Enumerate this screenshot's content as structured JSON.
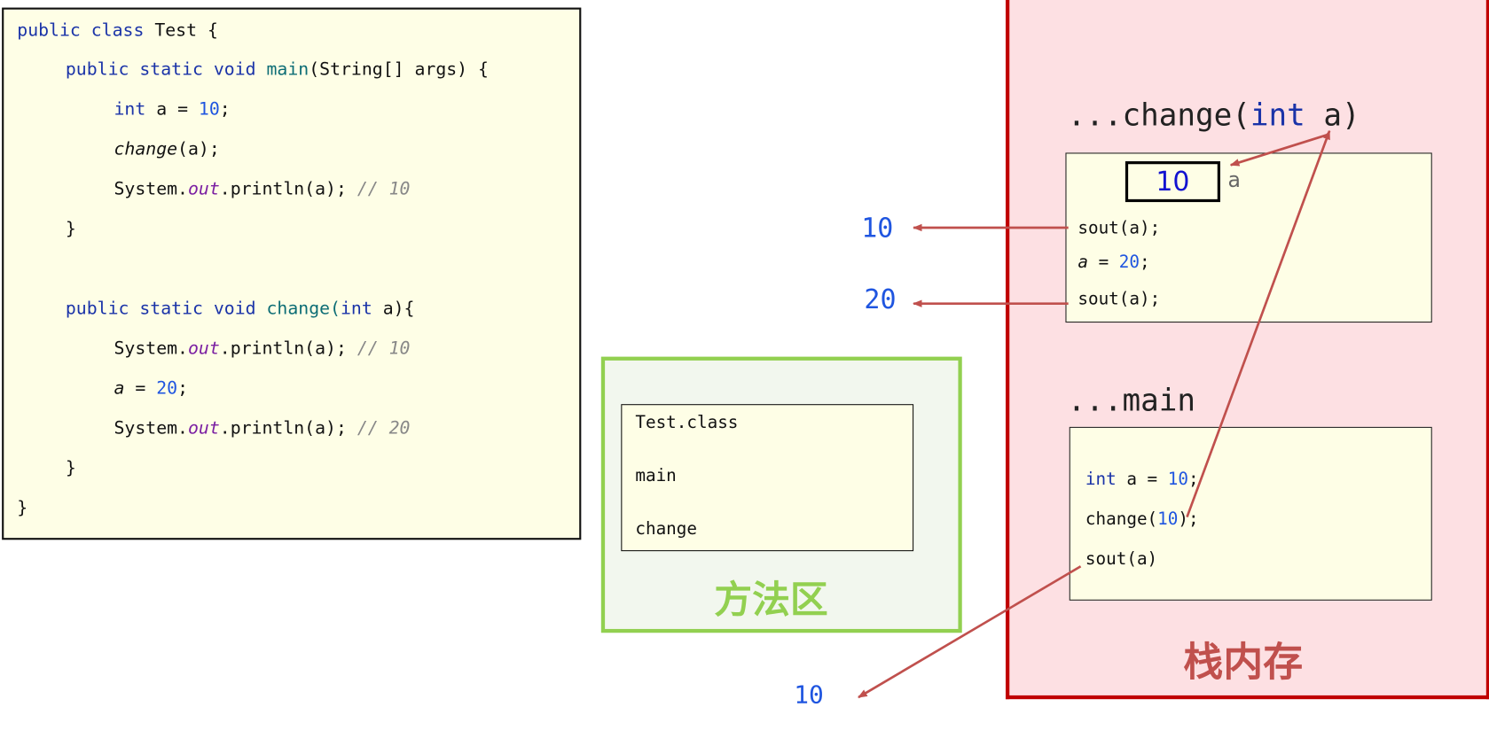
{
  "code": {
    "lines": [
      {
        "parts": [
          {
            "t": "public class ",
            "c": "kw"
          },
          {
            "t": "Test {",
            "c": ""
          }
        ]
      },
      {
        "parts": [
          {
            "t": "public static void ",
            "c": "kw"
          },
          {
            "t": "main",
            "c": "fn"
          },
          {
            "t": "(String[] args) {",
            "c": ""
          }
        ]
      },
      {
        "parts": [
          {
            "t": "int ",
            "c": "kw"
          },
          {
            "t": "a = ",
            "c": ""
          },
          {
            "t": "10",
            "c": "num"
          },
          {
            "t": ";",
            "c": ""
          }
        ]
      },
      {
        "parts": [
          {
            "t": "change",
            "c": "it"
          },
          {
            "t": "(a);",
            "c": ""
          }
        ]
      },
      {
        "parts": [
          {
            "t": "System.",
            "c": ""
          },
          {
            "t": "out",
            "c": "st"
          },
          {
            "t": ".println(a); ",
            "c": ""
          },
          {
            "t": "// 10",
            "c": "cm"
          }
        ]
      },
      {
        "parts": [
          {
            "t": "}",
            "c": ""
          }
        ]
      },
      {
        "parts": [
          {
            "t": "public static void ",
            "c": "kw"
          },
          {
            "t": "change",
            "c": "fn"
          },
          {
            "t": "(",
            "c": "fn"
          },
          {
            "t": "int ",
            "c": "kw"
          },
          {
            "t": "a){",
            "c": ""
          }
        ]
      },
      {
        "parts": [
          {
            "t": "System.",
            "c": ""
          },
          {
            "t": "out",
            "c": "st"
          },
          {
            "t": ".println(a); ",
            "c": ""
          },
          {
            "t": "// 10",
            "c": "cm"
          }
        ]
      },
      {
        "parts": [
          {
            "t": "a",
            "c": "it"
          },
          {
            "t": " = ",
            "c": ""
          },
          {
            "t": "20",
            "c": "num"
          },
          {
            "t": ";",
            "c": ""
          }
        ]
      },
      {
        "parts": [
          {
            "t": "System.",
            "c": ""
          },
          {
            "t": "out",
            "c": "st"
          },
          {
            "t": ".println(a); ",
            "c": ""
          },
          {
            "t": "// 20",
            "c": "cm"
          }
        ]
      },
      {
        "parts": [
          {
            "t": "}",
            "c": ""
          }
        ]
      },
      {
        "parts": [
          {
            "t": "}",
            "c": ""
          }
        ]
      }
    ]
  },
  "method_area": {
    "label": "方法区",
    "items": [
      "Test.class",
      "main",
      "change"
    ],
    "color": "#92d050"
  },
  "stack": {
    "label": "栈内存",
    "color": "#c00000",
    "change_frame": {
      "title_prefix": "...change(",
      "title_kw": "int",
      "title_suffix": " a)",
      "var_value": "10",
      "var_name": "a",
      "line1": "sout(a);",
      "line2_var": "a",
      "line2_eq": " = ",
      "line2_num": "20",
      "line2_end": ";",
      "line3": "sout(a);"
    },
    "main_frame": {
      "title": "...main",
      "line1_kw": "int",
      "line1_mid": " a = ",
      "line1_num": "10",
      "line1_end": ";",
      "line2_pre": "change(",
      "line2_num": "10",
      "line2_end": ");",
      "line3": "sout(a)"
    }
  },
  "outputs": [
    "10",
    "20",
    "10"
  ],
  "arrow_color": "#c0504d"
}
